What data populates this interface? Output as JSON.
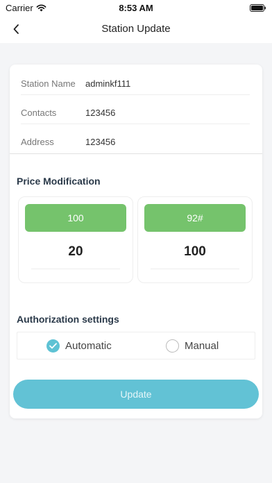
{
  "status_bar": {
    "carrier": "Carrier",
    "time": "8:53 AM"
  },
  "nav": {
    "title": "Station Update"
  },
  "station": {
    "fields": [
      {
        "label": "Station Name",
        "value": "adminkf111"
      },
      {
        "label": "Contacts",
        "value": "123456"
      },
      {
        "label": "Address",
        "value": "123456"
      }
    ]
  },
  "price": {
    "title": "Price Modification",
    "items": [
      {
        "tag": "100",
        "amount": "20"
      },
      {
        "tag": "92#",
        "amount": "100"
      }
    ]
  },
  "auth": {
    "title": "Authorization settings",
    "options": [
      {
        "label": "Automatic",
        "checked": true
      },
      {
        "label": "Manual",
        "checked": false
      }
    ]
  },
  "update_label": "Update",
  "colors": {
    "accent": "#62c2d5",
    "tag_green": "#75c36c",
    "radio_checked": "#5ec2d4"
  }
}
